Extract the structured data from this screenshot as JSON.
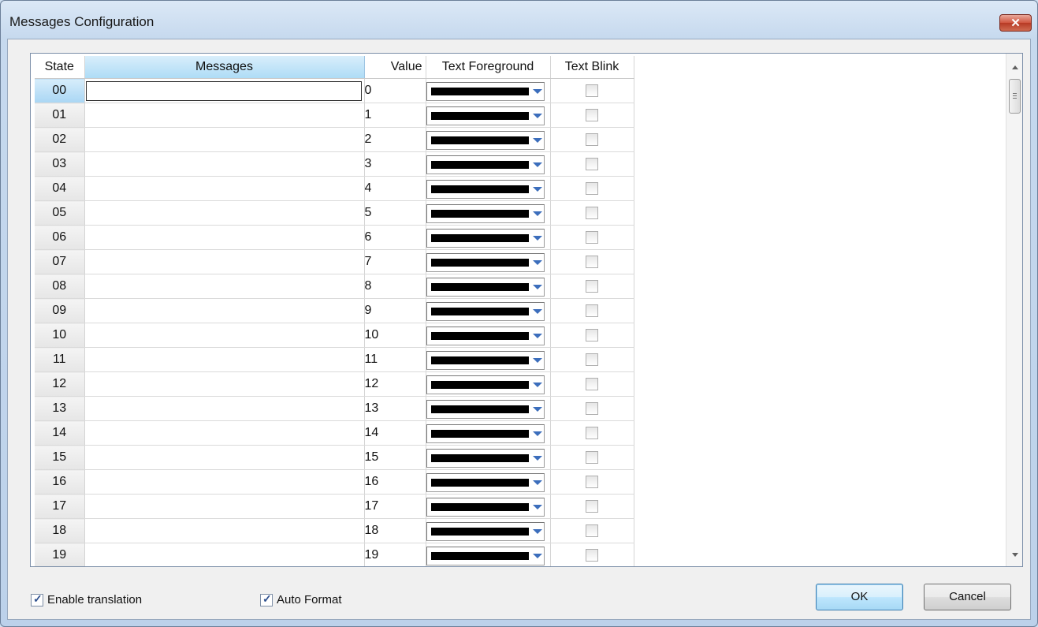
{
  "window": {
    "title": "Messages Configuration",
    "close_label": "✕"
  },
  "grid": {
    "columns": {
      "state": "State",
      "messages": "Messages",
      "value": "Value",
      "text_foreground": "Text Foreground",
      "text_blink": "Text Blink"
    },
    "selected_row": "00",
    "rows": [
      {
        "state": "00",
        "message": "",
        "value": "0",
        "foreground": "#000000",
        "blink": false
      },
      {
        "state": "01",
        "message": "",
        "value": "1",
        "foreground": "#000000",
        "blink": false
      },
      {
        "state": "02",
        "message": "",
        "value": "2",
        "foreground": "#000000",
        "blink": false
      },
      {
        "state": "03",
        "message": "",
        "value": "3",
        "foreground": "#000000",
        "blink": false
      },
      {
        "state": "04",
        "message": "",
        "value": "4",
        "foreground": "#000000",
        "blink": false
      },
      {
        "state": "05",
        "message": "",
        "value": "5",
        "foreground": "#000000",
        "blink": false
      },
      {
        "state": "06",
        "message": "",
        "value": "6",
        "foreground": "#000000",
        "blink": false
      },
      {
        "state": "07",
        "message": "",
        "value": "7",
        "foreground": "#000000",
        "blink": false
      },
      {
        "state": "08",
        "message": "",
        "value": "8",
        "foreground": "#000000",
        "blink": false
      },
      {
        "state": "09",
        "message": "",
        "value": "9",
        "foreground": "#000000",
        "blink": false
      },
      {
        "state": "10",
        "message": "",
        "value": "10",
        "foreground": "#000000",
        "blink": false
      },
      {
        "state": "11",
        "message": "",
        "value": "11",
        "foreground": "#000000",
        "blink": false
      },
      {
        "state": "12",
        "message": "",
        "value": "12",
        "foreground": "#000000",
        "blink": false
      },
      {
        "state": "13",
        "message": "",
        "value": "13",
        "foreground": "#000000",
        "blink": false
      },
      {
        "state": "14",
        "message": "",
        "value": "14",
        "foreground": "#000000",
        "blink": false
      },
      {
        "state": "15",
        "message": "",
        "value": "15",
        "foreground": "#000000",
        "blink": false
      },
      {
        "state": "16",
        "message": "",
        "value": "16",
        "foreground": "#000000",
        "blink": false
      },
      {
        "state": "17",
        "message": "",
        "value": "17",
        "foreground": "#000000",
        "blink": false
      },
      {
        "state": "18",
        "message": "",
        "value": "18",
        "foreground": "#000000",
        "blink": false
      },
      {
        "state": "19",
        "message": "",
        "value": "19",
        "foreground": "#000000",
        "blink": false
      }
    ]
  },
  "options": {
    "enable_translation": {
      "label": "Enable translation",
      "checked": true
    },
    "auto_format": {
      "label": "Auto Format",
      "checked": true
    }
  },
  "buttons": {
    "ok": "OK",
    "cancel": "Cancel"
  },
  "icons": {
    "check_mark": "✓"
  }
}
